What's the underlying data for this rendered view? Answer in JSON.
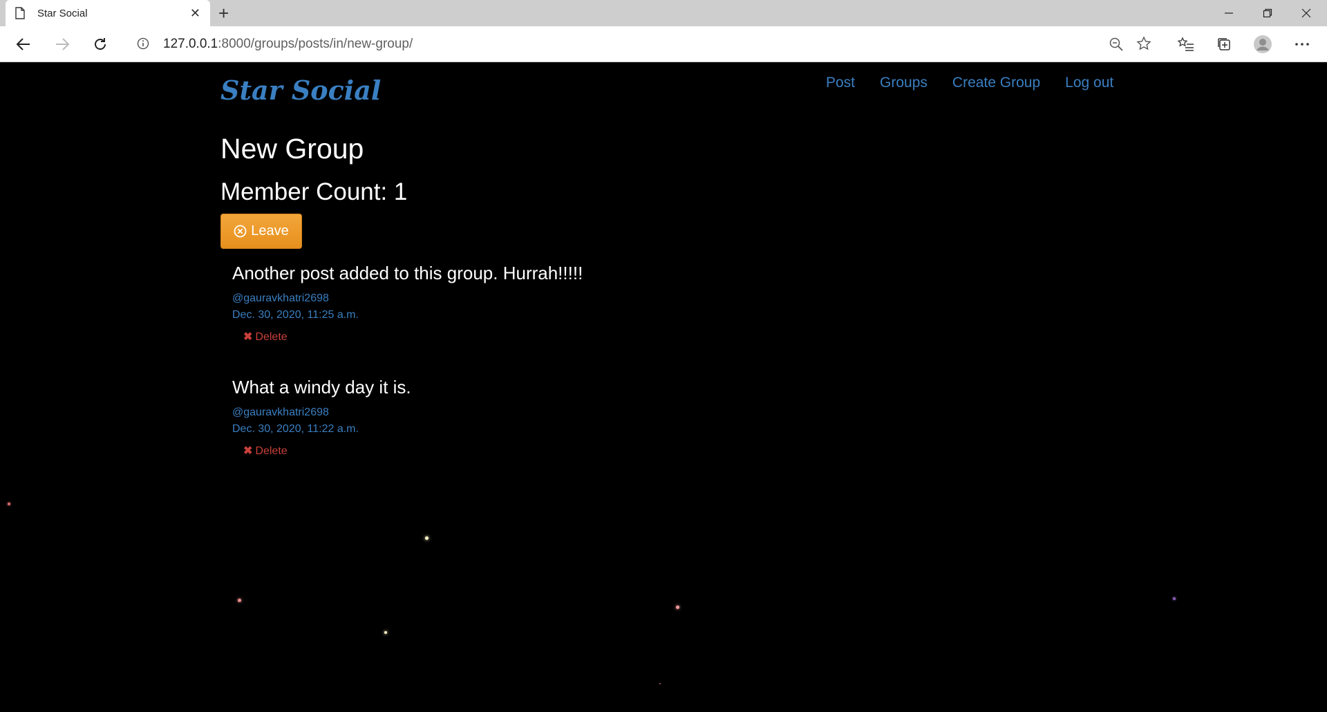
{
  "browser": {
    "tab_title": "Star Social",
    "url_host": "127.0.0.1",
    "url_rest": ":8000/groups/posts/in/new-group/"
  },
  "site": {
    "brand": "Star Social",
    "nav": {
      "post": "Post",
      "groups": "Groups",
      "create_group": "Create Group",
      "logout": "Log out"
    }
  },
  "group": {
    "title": "New Group",
    "member_count_label": "Member Count: 1",
    "leave_label": "Leave"
  },
  "posts": [
    {
      "text": "Another post added to this group. Hurrah!!!!!",
      "user": "@gauravkhatri2698",
      "time": "Dec. 30, 2020, 11:25 a.m.",
      "delete_label": "Delete"
    },
    {
      "text": "What a windy day it is.",
      "user": "@gauravkhatri2698",
      "time": "Dec. 30, 2020, 11:22 a.m.",
      "delete_label": "Delete"
    }
  ],
  "colors": {
    "background": "#000000",
    "link": "#3a7fc1",
    "leave_button": "#f0a030",
    "delete": "#c9403a"
  }
}
